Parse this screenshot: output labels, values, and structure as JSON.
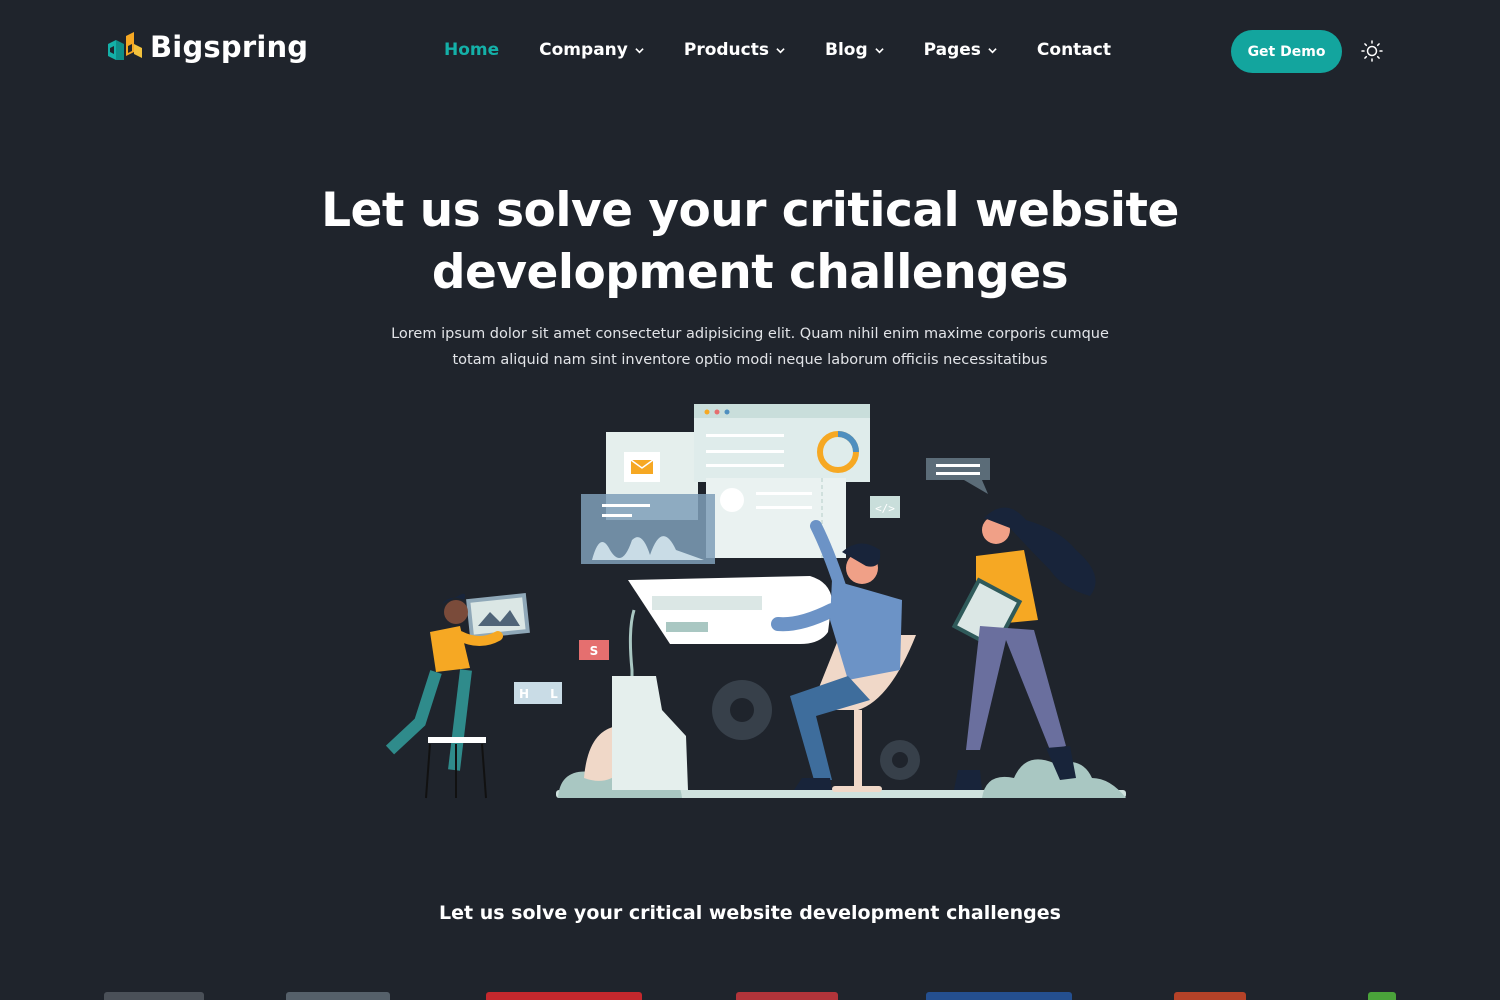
{
  "brand": {
    "name": "Bigspring",
    "logo_icon": "bigspring-logo-icon"
  },
  "nav": {
    "items": [
      {
        "label": "Home",
        "active": true,
        "has_dropdown": false
      },
      {
        "label": "Company",
        "active": false,
        "has_dropdown": true
      },
      {
        "label": "Products",
        "active": false,
        "has_dropdown": true
      },
      {
        "label": "Blog",
        "active": false,
        "has_dropdown": true
      },
      {
        "label": "Pages",
        "active": false,
        "has_dropdown": true
      },
      {
        "label": "Contact",
        "active": false,
        "has_dropdown": false
      }
    ],
    "cta_label": "Get Demo",
    "theme_toggle_icon": "sun-icon"
  },
  "hero": {
    "title_line1": "Let us solve your critical website",
    "title_line2": "development challenges",
    "subtitle_line1": "Lorem ipsum dolor sit amet consectetur adipisicing elit. Quam nihil enim maxime corporis cumque",
    "subtitle_line2": "totam aliquid nam sint inventore optio modi neque laborum officiis necessitatibus",
    "illustration": "team-web-development-illustration",
    "labels": {
      "s_tile": "S",
      "h_tile": "H",
      "l_tile": "L",
      "code_tag": "</>"
    }
  },
  "clients": {
    "title": "Let us solve your critical website development challenges",
    "logos": [
      "client-logo",
      "client-logo",
      "client-logo",
      "client-logo",
      "client-logo",
      "client-logo",
      "client-logo"
    ]
  },
  "colors": {
    "background": "#1f242c",
    "accent": "#14b0a8",
    "button": "#13a59e",
    "text": "#ffffff"
  }
}
